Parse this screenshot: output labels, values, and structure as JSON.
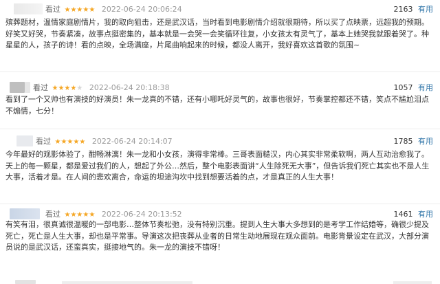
{
  "reviews": [
    {
      "label": "看过",
      "rating": 5,
      "stars_text": "★★★★★",
      "date": "2022-06-24 20:06:24",
      "votes": "2163",
      "useful_label": "有用",
      "text": "殡葬题材，温情家庭剧情片，我的取向狙击，还是武汉话，当时看到电影剧情介绍就很期待，所以买了点映票，远超我的预期。好笑又好哭，节奏紧凑，故事点挺密集的，基本就是一会哭一会笑循环往复，小女孩太有灵气了，基本上她哭我就跟着哭了。种星星的人，孩子的诗！看的点映，全场满座，片尾曲响起来的时候，都没人离开，我好喜欢这首歌的氛围~"
    },
    {
      "label": "看过",
      "rating": 4,
      "stars_text": "★★★★",
      "stars_off": "★",
      "date": "2022-06-24 20:18:38",
      "votes": "1057",
      "useful_label": "有用",
      "text": "看到了一个又帅也有演技的好演员！朱一龙真的不错，还有小哪吒好灵气的，故事也很好，节奏掌控都还不错，笑点不尴尬泪点不煽情，七分！"
    },
    {
      "label": "看过",
      "rating": 5,
      "stars_text": "★★★★★",
      "date": "2022-06-24 20:14:07",
      "votes": "1785",
      "useful_label": "有用",
      "text": "今年最好的观影体验了，酣畅淋漓！朱一龙和小女孩，演得非常棒。三哥表面糙汉，内心其实非常柔软啊，两人互动治愈我了。天上的每一颗星，都是爱过我们的人，想起了外公…然后，整个电影表面讲“人生除死无大事”，但告诉我们死亡其实也不是人生大事，活着才是。在人间的悲欢离合，命运的坦途沟坎中找到想要活着的点，才是真正的人生大事！"
    },
    {
      "label": "看过",
      "rating": 5,
      "stars_text": "★★★★★",
      "date": "2022-06-24 20:13:52",
      "votes": "1461",
      "useful_label": "有用",
      "text": "有笑有泪，很真诚很温暖的一部电影…整体节奏松弛，没有特别沉重。提到人生大事大多想到的是考学工作结婚等，确很少提及死亡，死亡是人生大事，却也是平常事。导演这次把丧葬从业者的日常生动地展现在观众面前。电影背景设定在武汉，大部分演员说的是武汉话，还蛮真实，挺接地气的。朱一龙的演技不错呀！"
    }
  ],
  "colors": {
    "star": "#f5a623",
    "useful": "#3377aa",
    "date": "#9a9a9a"
  }
}
